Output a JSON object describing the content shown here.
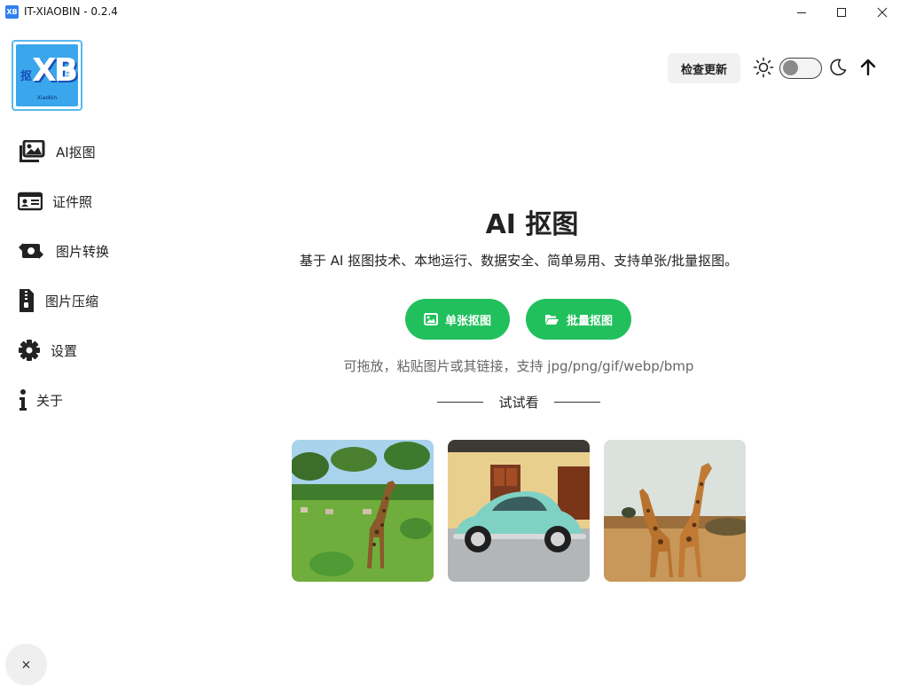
{
  "window": {
    "title": "IT-XIAOBIN - 0.2.4",
    "app_icon_text": "XB"
  },
  "logo": {
    "main": "XB",
    "left_char": "抠",
    "right_char": "图",
    "sub": "Xiaobin"
  },
  "sidebar": {
    "items": [
      {
        "label": "AI抠图",
        "icon": "images-icon"
      },
      {
        "label": "证件照",
        "icon": "id-card-icon"
      },
      {
        "label": "图片转换",
        "icon": "convert-icon"
      },
      {
        "label": "图片压缩",
        "icon": "zip-file-icon"
      },
      {
        "label": "设置",
        "icon": "gear-icon"
      },
      {
        "label": "关于",
        "icon": "info-icon"
      }
    ]
  },
  "header": {
    "update_label": "检查更新",
    "theme_toggle_on": false
  },
  "main": {
    "title": "AI 抠图",
    "subtitle": "基于 AI 抠图技术、本地运行、数据安全、简单易用、支持单张/批量抠图。",
    "single_button": "单张抠图",
    "batch_button": "批量抠图",
    "hint": "可拖放，粘贴图片或其链接，支持 jpg/png/gif/webp/bmp",
    "try_label": "试试看"
  },
  "close_fab": "×",
  "colors": {
    "accent_green": "#22c05d",
    "logo_blue": "#3aa7ec"
  }
}
